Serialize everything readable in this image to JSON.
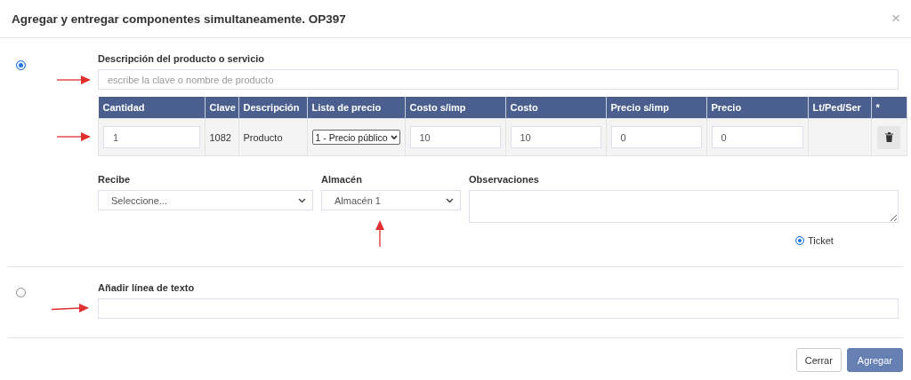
{
  "dialog": {
    "title": "Agregar y entregar componentes simultaneamente. OP397",
    "close": "×"
  },
  "product_section": {
    "selected": true,
    "label": "Descripción del producto o servicio",
    "search": {
      "placeholder": "escribe la clave o nombre de producto"
    }
  },
  "table": {
    "columns": [
      "Cantidad",
      "Clave",
      "Descripción",
      "Lista de precio",
      "Costo s/imp",
      "Costo",
      "Precio s/imp",
      "Precio",
      "Lt/Ped/Ser",
      "*"
    ],
    "rows": [
      {
        "cantidad": "1",
        "clave": "1082",
        "descripcion": "Producto",
        "lista_de_precio": "1 - Precio público",
        "costo_s_imp": "10",
        "costo": "10",
        "precio_s_imp": "0",
        "precio": "0"
      }
    ]
  },
  "recibe": {
    "label": "Recibe",
    "value": "Seleccione..."
  },
  "almacen": {
    "label": "Almacén",
    "value": "Almacén 1"
  },
  "observaciones": {
    "label": "Observaciones"
  },
  "ticket": {
    "label": "Ticket",
    "selected": true
  },
  "text_line_section": {
    "selected": false,
    "label": "Añadir línea de texto"
  },
  "buttons": [
    {
      "label": "Cerrar",
      "kind": "secondary"
    },
    {
      "label": "Agregar",
      "kind": "primary"
    }
  ]
}
